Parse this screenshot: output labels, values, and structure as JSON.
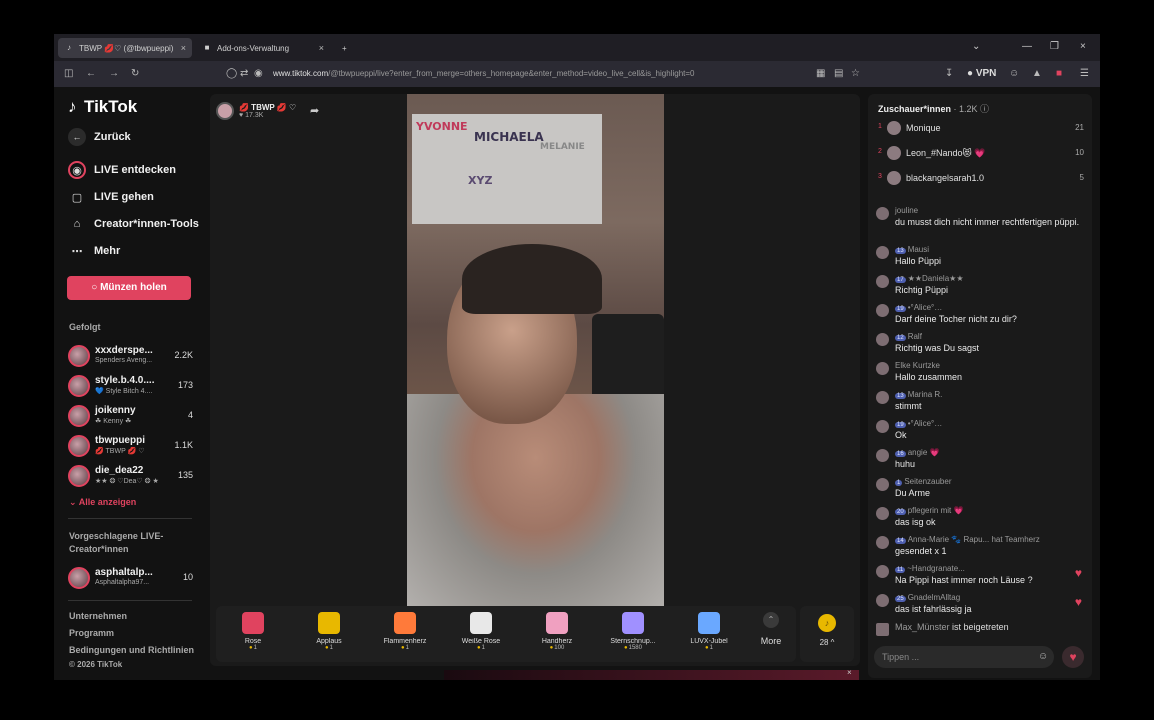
{
  "browser": {
    "tabs": [
      {
        "label": "TBWP 💋♡ (@tbwpueppi)",
        "active": true
      },
      {
        "label": "Add-ons-Verwaltung",
        "active": false
      }
    ],
    "new_tab": "+",
    "url_domain": "www.tiktok.com",
    "url_rest": "/@tbwpueppi/live?enter_from_merge=others_homepage&enter_method=video_live_cell&is_highlight=0",
    "vpn_label": "VPN"
  },
  "sidebar": {
    "logo": "TikTok",
    "back": "Zurück",
    "nav": [
      {
        "label": "LIVE entdecken",
        "icon": "live-discover-icon"
      },
      {
        "label": "LIVE gehen",
        "icon": "camera-icon"
      },
      {
        "label": "Creator*innen-Tools",
        "icon": "home-icon"
      },
      {
        "label": "Mehr",
        "icon": "more-dots-icon"
      }
    ],
    "coins_button": "Münzen holen",
    "followed_title": "Gefolgt",
    "followed": [
      {
        "name": "xxxderspe...",
        "sub": "Spenders Aveng...",
        "count": "2.2K"
      },
      {
        "name": "style.b.4.0....",
        "sub": "💙 Style Bitch 4....",
        "count": "173"
      },
      {
        "name": "joikenny",
        "sub": "☘ Kenny ☘",
        "count": "4"
      },
      {
        "name": "tbwpueppi",
        "sub": "💋 TBWP 💋 ♡",
        "count": "1.1K"
      },
      {
        "name": "die_dea22",
        "sub": "★★ ❂ ♡Dea♡ ❂ ★",
        "count": "135"
      }
    ],
    "show_all": "Alle anzeigen",
    "suggested_title": "Vorgeschlagene LIVE-Creator*innen",
    "suggested": [
      {
        "name": "asphaltalp...",
        "sub": "Asphaltalpha97...",
        "count": "10"
      }
    ],
    "footer": [
      "Unternehmen",
      "Programm",
      "Bedingungen und Richtlinien",
      "© 2026 TikTok"
    ]
  },
  "stream": {
    "host_name": "💋 TBWP 💋 ♡",
    "likes": "17.3K",
    "board_names": [
      "YVONNE",
      "MICHAELA",
      "MELANIE",
      "XYZ"
    ]
  },
  "gifts": [
    {
      "name": "Rose",
      "price": "1",
      "color": "#e0435f"
    },
    {
      "name": "Applaus",
      "price": "1",
      "color": "#e8b800"
    },
    {
      "name": "Flammenherz",
      "price": "1",
      "color": "#ff7a3a"
    },
    {
      "name": "Weiße Rose",
      "price": "1",
      "color": "#e8e8e8"
    },
    {
      "name": "Handherz",
      "price": "100",
      "color": "#f0a0c0"
    },
    {
      "name": "Sternschnup...",
      "price": "1580",
      "color": "#a090ff"
    },
    {
      "name": "LUVX-Jubel",
      "price": "1",
      "color": "#6aa8ff"
    }
  ],
  "more_label": "More",
  "coin_balance": "28 ^",
  "chat": {
    "title": "Zuschauer*innen",
    "viewer_count": "1.2K",
    "top_viewers": [
      {
        "rank": "1",
        "name": "Monique",
        "score": "21"
      },
      {
        "rank": "2",
        "name": "Leon_#Nando😻 💗",
        "score": "10"
      },
      {
        "rank": "3",
        "name": "blackangelsarah1.0",
        "score": "5"
      }
    ],
    "messages": [
      {
        "user": "jouline",
        "badge": "",
        "text": "du musst dich nicht immer rechtfertigen püppi."
      },
      {
        "user": "Mausi",
        "badge": "13",
        "text": "Hallo Püppi"
      },
      {
        "user": "★★Daniela★★",
        "badge": "17",
        "text": "Richtig Püppi"
      },
      {
        "user": "•°Alice°…",
        "badge": "19",
        "text": "Darf deine Tocher nicht zu dir?"
      },
      {
        "user": "Ralf",
        "badge": "12",
        "text": "Richtig was Du sagst"
      },
      {
        "user": "Elke Kurtzke",
        "badge": "",
        "text": "Hallo zusammen"
      },
      {
        "user": "Marina R.",
        "badge": "13",
        "text": "stimmt"
      },
      {
        "user": "•°Alice°…",
        "badge": "19",
        "text": "Ok"
      },
      {
        "user": "angie 💗",
        "badge": "16",
        "text": "huhu"
      },
      {
        "user": "Seitenzauber",
        "badge": "1",
        "text": "Du Arme"
      },
      {
        "user": "pflegerin mit 💗",
        "badge": "20",
        "text": "das isg ok"
      },
      {
        "user": "Anna-Marie 🐾 Rapu...  hat Teamherz",
        "badge": "14",
        "text": "gesendet x 1"
      },
      {
        "user": "~Handgranate...",
        "badge": "11",
        "text": "Na Pippi hast immer noch Läuse ?"
      },
      {
        "user": "GnadelmAlltag",
        "badge": "25",
        "text": "das ist fahrlässig ja"
      },
      {
        "user": "Max_Münster",
        "badge": "",
        "text": "ist beigetreten"
      }
    ],
    "input_placeholder": "Tippen ..."
  }
}
